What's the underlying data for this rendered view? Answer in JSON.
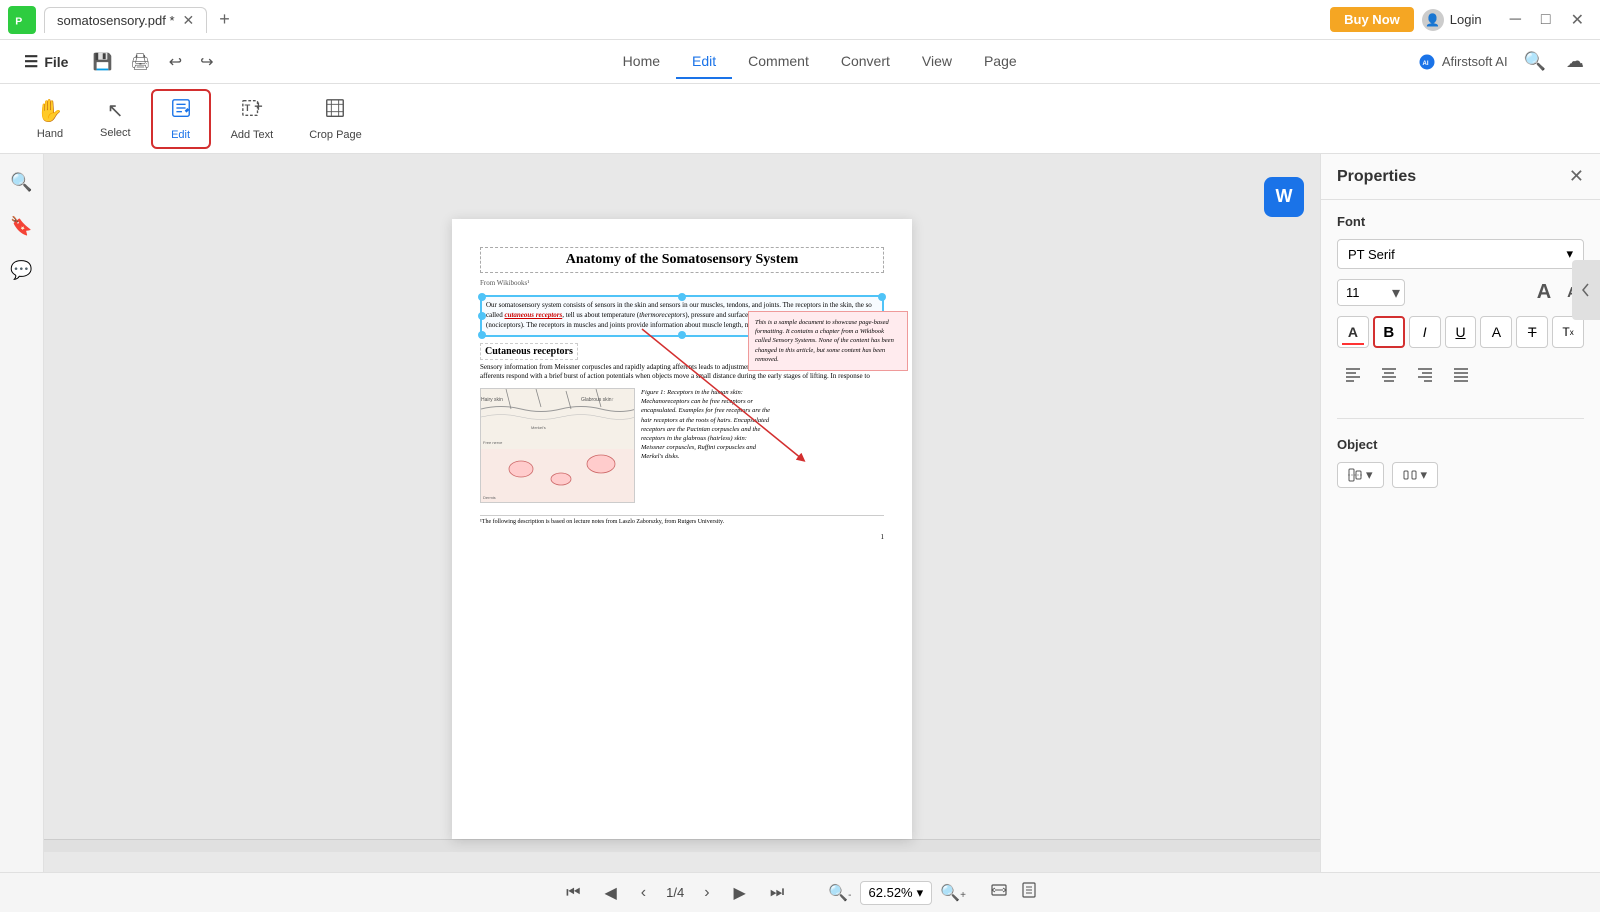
{
  "titlebar": {
    "tab_label": "somatosensory.pdf *",
    "buy_now": "Buy Now",
    "login": "Login"
  },
  "menubar": {
    "file": "File",
    "undo": "↩",
    "redo": "↪",
    "save": "💾",
    "print": "🖨",
    "tabs": [
      "Home",
      "Edit",
      "Comment",
      "Convert",
      "View",
      "Page"
    ],
    "active_tab": "Edit",
    "ai_label": "Afirstsoft AI",
    "search_icon": "🔍",
    "cloud_icon": "☁"
  },
  "toolbar": {
    "tools": [
      {
        "id": "hand",
        "icon": "✋",
        "label": "Hand"
      },
      {
        "id": "select",
        "icon": "↖",
        "label": "Select"
      },
      {
        "id": "edit",
        "icon": "✏️",
        "label": "Edit",
        "active": true
      },
      {
        "id": "add-text",
        "icon": "T+",
        "label": "Add Text"
      },
      {
        "id": "crop",
        "icon": "⊡",
        "label": "Crop Page"
      }
    ]
  },
  "sidebar": {
    "icons": [
      "🔍",
      "🔖",
      "💬"
    ]
  },
  "pdf": {
    "title": "Anatomy of the Somatosensory System",
    "from": "From Wikibooks¹",
    "main_text": "Our somatosensory system consists of sensors in the skin and sensors in our muscles, tendons, and joints. The receptors in the skin, the so called cutaneous receptors, tell us about temperature (thermoreceptors), pressure and surface texture (mechano receptors), and pain (nociceptors). The receptors in muscles and joints provide information about muscle length, muscle tension, and joint angles.",
    "comment": "This is a sample document to showcase page-based formatting. It contains a chapter from a Wikibook called Sensory Systems. None of the content has been changed in this article, but some content has been removed.",
    "cutaneous_title": "Cutaneous receptors",
    "cutaneous_text": "Sensory information from Meissner corpuscles and rapidly adapting afferents leads to adjustment of grip force when objects are lifted. These afferents respond with a brief burst of action potentials when objects move a small distance during the early stages of lifting. In response to",
    "figure_caption": "Figure 1: Receptors in the human skin: Mechanoreceptors can be free receptors or encapsulated. Examples for free receptors are the hair receptors at the roots of hairs. Encapsulated receptors are the Pacinian corpuscles and the receptors in the glabrous (hairless) skin: Meissner corpuscles, Ruffini corpuscles and Merkel's disks.",
    "footnote": "¹The following description is based on lecture notes from Laszlo Zaborszky, from Rutgers University.",
    "page_num": "1"
  },
  "properties": {
    "title": "Properties",
    "font_section": "Font",
    "font_name": "PT Serif",
    "font_size": "11",
    "object_section": "Object"
  },
  "bottom": {
    "page_indicator": "1/4",
    "zoom_value": "62.52%"
  }
}
